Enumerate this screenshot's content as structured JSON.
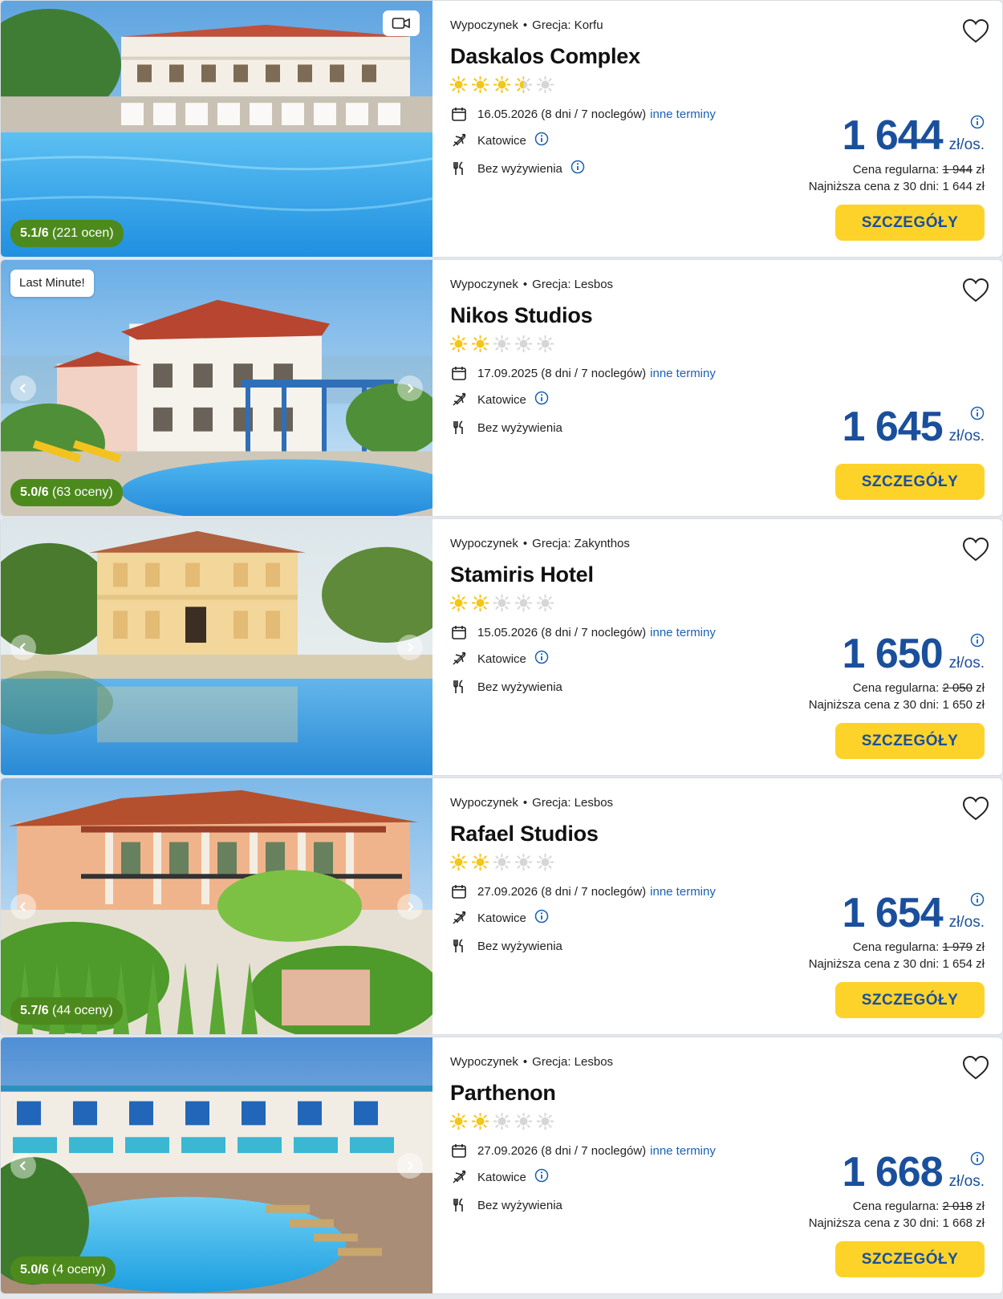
{
  "offers": [
    {
      "category": "Wypoczynek",
      "destination": "Grecja: Korfu",
      "name": "Daskalos Complex",
      "stars_filled": 3.5,
      "date": "16.05.2026 (8 dni / 7 noclegów)",
      "other_dates_label": "inne terminy",
      "departure": "Katowice",
      "board": "Bez wyżywienia",
      "price": "1 644",
      "price_unit": "zł/os.",
      "regular_label": "Cena regularna:",
      "regular_price": "1 944",
      "regular_currency": "zł",
      "lowest_label": "Najniższa cena z 30 dni: 1 644 zł",
      "button": "SZCZEGÓŁY",
      "rating_score": "5.1/6",
      "rating_count": "(221 ocen)",
      "badge": "",
      "has_video": true
    },
    {
      "category": "Wypoczynek",
      "destination": "Grecja: Lesbos",
      "name": "Nikos Studios",
      "stars_filled": 2,
      "date": "17.09.2025 (8 dni / 7 noclegów)",
      "other_dates_label": "inne terminy",
      "departure": "Katowice",
      "board": "Bez wyżywienia",
      "price": "1 645",
      "price_unit": "zł/os.",
      "regular_label": "",
      "regular_price": "",
      "regular_currency": "",
      "lowest_label": "",
      "button": "SZCZEGÓŁY",
      "rating_score": "5.0/6",
      "rating_count": "(63 oceny)",
      "badge": "Last Minute!",
      "has_video": false
    },
    {
      "category": "Wypoczynek",
      "destination": "Grecja: Zakynthos",
      "name": "Stamiris Hotel",
      "stars_filled": 2,
      "date": "15.05.2026 (8 dni / 7 noclegów)",
      "other_dates_label": "inne terminy",
      "departure": "Katowice",
      "board": "Bez wyżywienia",
      "price": "1 650",
      "price_unit": "zł/os.",
      "regular_label": "Cena regularna:",
      "regular_price": "2 050",
      "regular_currency": "zł",
      "lowest_label": "Najniższa cena z 30 dni: 1 650 zł",
      "button": "SZCZEGÓŁY",
      "rating_score": "",
      "rating_count": "",
      "badge": "",
      "has_video": false
    },
    {
      "category": "Wypoczynek",
      "destination": "Grecja: Lesbos",
      "name": "Rafael Studios",
      "stars_filled": 2,
      "date": "27.09.2026 (8 dni / 7 noclegów)",
      "other_dates_label": "inne terminy",
      "departure": "Katowice",
      "board": "Bez wyżywienia",
      "price": "1 654",
      "price_unit": "zł/os.",
      "regular_label": "Cena regularna:",
      "regular_price": "1 979",
      "regular_currency": "zł",
      "lowest_label": "Najniższa cena z 30 dni: 1 654 zł",
      "button": "SZCZEGÓŁY",
      "rating_score": "5.7/6",
      "rating_count": "(44 oceny)",
      "badge": "",
      "has_video": false
    },
    {
      "category": "Wypoczynek",
      "destination": "Grecja: Lesbos",
      "name": "Parthenon",
      "stars_filled": 2,
      "date": "27.09.2026 (8 dni / 7 noclegów)",
      "other_dates_label": "inne terminy",
      "departure": "Katowice",
      "board": "Bez wyżywienia",
      "price": "1 668",
      "price_unit": "zł/os.",
      "regular_label": "Cena regularna:",
      "regular_price": "2 018",
      "regular_currency": "zł",
      "lowest_label": "Najniższa cena z 30 dni: 1 668 zł",
      "button": "SZCZEGÓŁY",
      "rating_score": "5.0/6",
      "rating_count": "(4 oceny)",
      "badge": "",
      "has_video": false
    }
  ],
  "colors": {
    "price_blue": "#1a4f9c",
    "link_blue": "#1a60b4",
    "button_yellow": "#fdd32a",
    "rating_green": "#4d8a1d",
    "star_gold": "#f5c518"
  },
  "icons": {
    "date": "calendar-icon",
    "departure": "plane-icon",
    "board": "cutlery-icon",
    "favorite": "heart-icon",
    "info": "info-icon"
  }
}
